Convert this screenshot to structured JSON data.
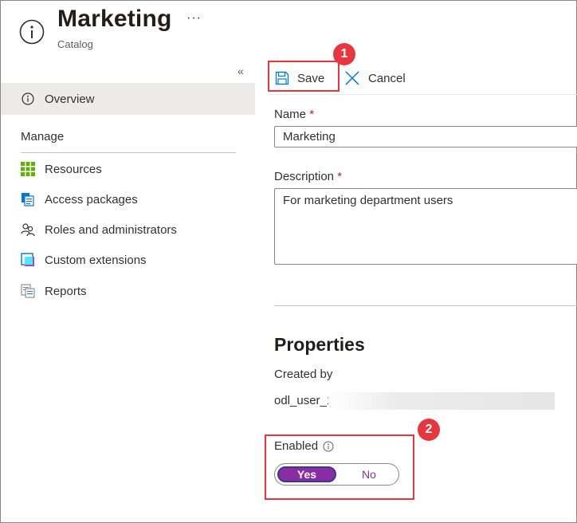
{
  "header": {
    "title": "Marketing",
    "subtitle": "Catalog",
    "more_label": "···"
  },
  "sidebar": {
    "collapse_label": "«",
    "overview_label": "Overview",
    "section_header": "Manage",
    "items": [
      {
        "label": "Resources",
        "icon": "grid-icon"
      },
      {
        "label": "Access packages",
        "icon": "packages-icon"
      },
      {
        "label": "Roles and administrators",
        "icon": "people-icon"
      },
      {
        "label": "Custom extensions",
        "icon": "extension-icon"
      },
      {
        "label": "Reports",
        "icon": "reports-icon"
      }
    ]
  },
  "toolbar": {
    "save_label": "Save",
    "cancel_label": "Cancel"
  },
  "form": {
    "name_label": "Name",
    "name_value": "Marketing",
    "description_label": "Description",
    "description_value": "For marketing department users",
    "required_marker": "*"
  },
  "properties": {
    "title": "Properties",
    "created_by_label": "Created by",
    "created_by_value": "odl_user_1",
    "enabled_label": "Enabled",
    "enabled_options": [
      "Yes",
      "No"
    ],
    "enabled_selected": "Yes"
  },
  "annotations": {
    "badge_1": "1",
    "badge_2": "2"
  },
  "colors": {
    "annotation_red": "#e8363f",
    "toggle_purple": "#8a2da5",
    "selected_nav_bg": "#edebe9",
    "required_red": "#a4262c",
    "link_blue": "#0078d4"
  }
}
